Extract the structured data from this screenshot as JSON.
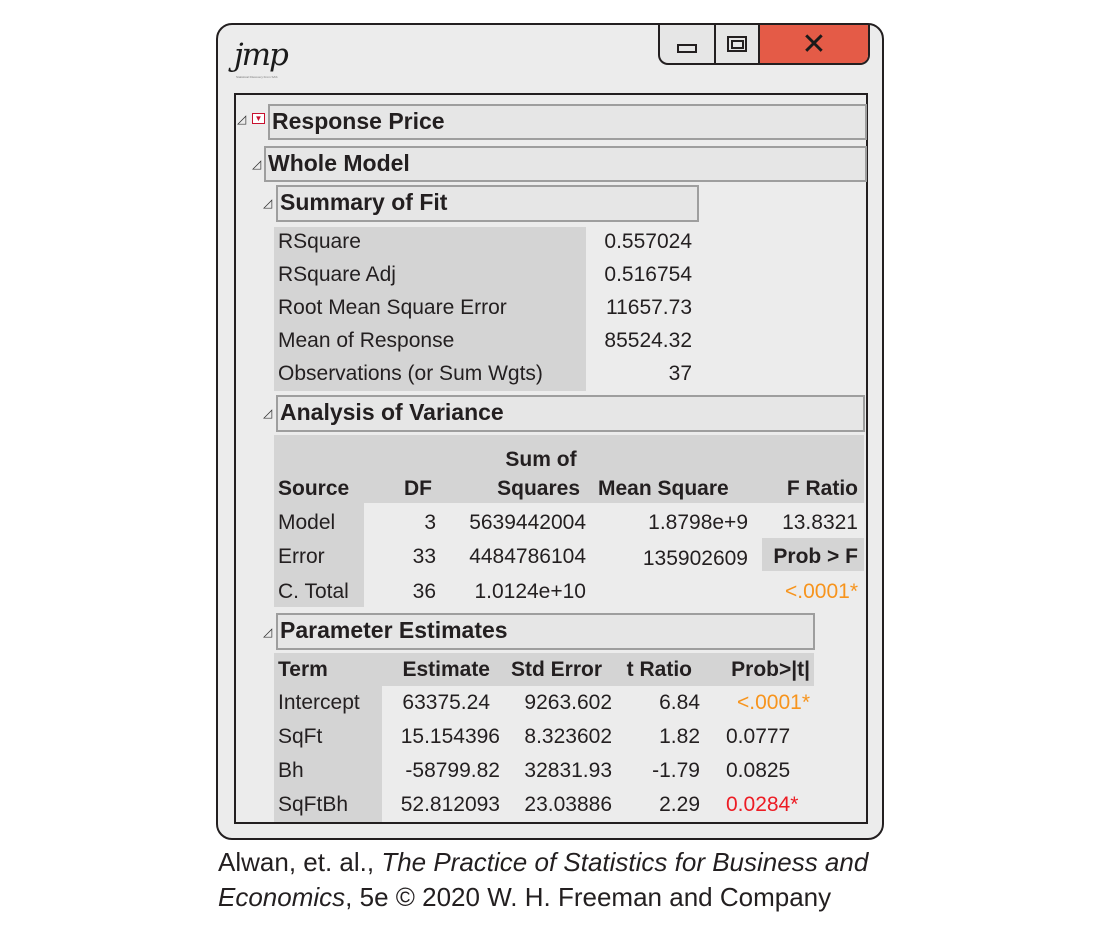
{
  "window": {
    "logo_text": "jmp",
    "logo_subtext": "Statistical Discovery From SAS",
    "close_glyph": "✕"
  },
  "response": {
    "title": "Response Price"
  },
  "whole_model": {
    "title": "Whole Model"
  },
  "summary_of_fit": {
    "title": "Summary of Fit",
    "rows": [
      {
        "label": "RSquare",
        "value": "0.557024"
      },
      {
        "label": "RSquare Adj",
        "value": "0.516754"
      },
      {
        "label": "Root Mean Square Error",
        "value": "11657.73"
      },
      {
        "label": "Mean of Response",
        "value": "85524.32"
      },
      {
        "label": "Observations (or Sum Wgts)",
        "value": "37"
      }
    ]
  },
  "anova": {
    "title": "Analysis of Variance",
    "headers": {
      "source": "Source",
      "df": "DF",
      "ss_top": "Sum of",
      "ss_bottom": "Squares",
      "ms": "Mean  Square",
      "f": "F Ratio"
    },
    "rows": [
      {
        "source": "Model",
        "df": "3",
        "ss": "5639442004",
        "ms": "1.8798e+9",
        "f": "13.8321"
      },
      {
        "source": "Error",
        "df": "33",
        "ss": "4484786104",
        "ms": "135902609",
        "f": "Prob > F"
      },
      {
        "source": "C. Total",
        "df": "36",
        "ss": "1.0124e+10",
        "ms": "",
        "f": "<.0001*"
      }
    ]
  },
  "parameters": {
    "title": "Parameter Estimates",
    "headers": {
      "term": "Term",
      "estimate": "Estimate",
      "stderr": "Std Error",
      "tratio": "t Ratio",
      "prob": "Prob>|t|"
    },
    "rows": [
      {
        "term": "Intercept",
        "estimate": "63375.24",
        "stderr": "9263.602",
        "tratio": "6.84",
        "prob": "<.0001*"
      },
      {
        "term": "SqFt",
        "estimate": "15.154396",
        "stderr": "8.323602",
        "tratio": "1.82",
        "prob": "0.0777"
      },
      {
        "term": "Bh",
        "estimate": "-58799.82",
        "stderr": "32831.93",
        "tratio": "-1.79",
        "prob": "0.0825"
      },
      {
        "term": "SqFtBh",
        "estimate": "52.812093",
        "stderr": "23.03886",
        "tratio": "2.29",
        "prob": "0.0284*"
      }
    ]
  },
  "caption": {
    "line1_prefix": "Alwan, et. al., ",
    "line1_italic": "The Practice of Statistics for Business and",
    "line2_italic": "Economics",
    "line2_suffix": ", 5e © 2020 W. H. Freeman and Company"
  },
  "colors": {
    "significant_orange": "#f7941d",
    "significant_red": "#ed1c24",
    "close_button": "#e45b47"
  }
}
